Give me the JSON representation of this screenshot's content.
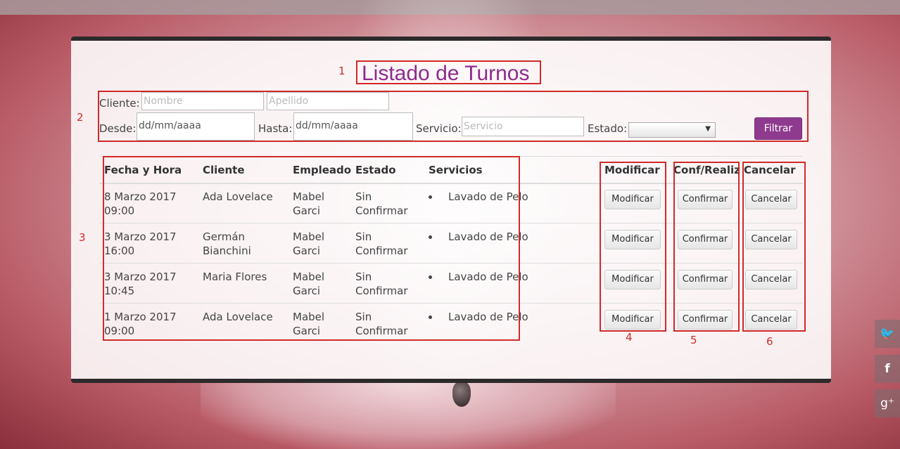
{
  "page": {
    "title": "Listado de Turnos"
  },
  "annotations": [
    "1",
    "2",
    "3",
    "4",
    "5",
    "6"
  ],
  "filters": {
    "cliente_label": "Cliente:",
    "nombre_placeholder": "Nombre",
    "apellido_placeholder": "Apellido",
    "desde_label": "Desde:",
    "desde_value": "dd/mm/aaaa",
    "hasta_label": "Hasta:",
    "hasta_value": "dd/mm/aaaa",
    "servicio_label": "Servicio:",
    "servicio_placeholder": "Servicio",
    "estado_label": "Estado:",
    "estado_arrow": "▼",
    "filtrar_label": "Filtrar"
  },
  "table": {
    "headers": [
      "Fecha y Hora",
      "Cliente",
      "Empleado",
      "Estado",
      "Servicios",
      "Modificar",
      "Conf/Realiz",
      "Cancelar"
    ],
    "rows": [
      {
        "fecha": "8 Marzo 2017",
        "hora": "09:00",
        "cliente1": "Ada Lovelace",
        "cliente2": "",
        "emp1": "Mabel",
        "emp2": "Garci",
        "estado1": "Sin",
        "estado2": "Confirmar",
        "servicio": "Lavado de Pelo"
      },
      {
        "fecha": "3 Marzo 2017",
        "hora": "16:00",
        "cliente1": "Germán",
        "cliente2": "Bianchini",
        "emp1": "Mabel",
        "emp2": "Garci",
        "estado1": "Sin",
        "estado2": "Confirmar",
        "servicio": "Lavado de Pelo"
      },
      {
        "fecha": "3 Marzo 2017",
        "hora": "10:45",
        "cliente1": "Maria Flores",
        "cliente2": "",
        "emp1": "Mabel",
        "emp2": "Garci",
        "estado1": "Sin",
        "estado2": "Confirmar",
        "servicio": "Lavado de Pelo"
      },
      {
        "fecha": "1 Marzo 2017",
        "hora": "09:00",
        "cliente1": "Ada Lovelace",
        "cliente2": "",
        "emp1": "Mabel",
        "emp2": "Garci",
        "estado1": "Sin",
        "estado2": "Confirmar",
        "servicio": "Lavado de Pelo"
      }
    ],
    "modificar_label": "Modificar",
    "confirmar_label": "Confirmar",
    "cancelar_label": "Cancelar"
  },
  "social": {
    "twitter_icon": "twitter-icon",
    "facebook_icon": "facebook-icon",
    "gplus_icon": "google-plus-icon",
    "twitter": "🐦",
    "facebook": "f",
    "gplus": "g⁺"
  },
  "colors": {
    "title": "#8e2a8e",
    "annotation": "#d02a2a",
    "filtrar_button": "#8e3a8e"
  }
}
